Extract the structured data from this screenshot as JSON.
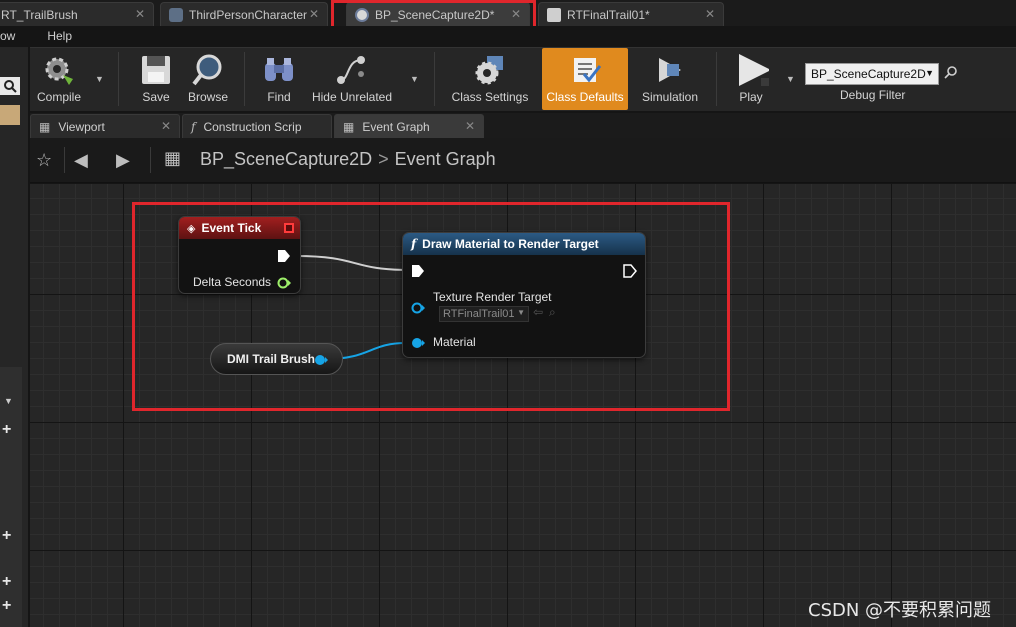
{
  "doc_tabs": [
    {
      "label": "RT_TrailBrush",
      "active": false
    },
    {
      "label": "ThirdPersonCharacter",
      "active": false
    },
    {
      "label": "BP_SceneCapture2D*",
      "active": true
    },
    {
      "label": "RTFinalTrail01*",
      "active": false
    }
  ],
  "menu": {
    "window": "ow",
    "help": "Help"
  },
  "toolbar": {
    "compile": "Compile",
    "save": "Save",
    "browse": "Browse",
    "find": "Find",
    "hide_unrelated": "Hide Unrelated",
    "class_settings": "Class Settings",
    "class_defaults": "Class Defaults",
    "simulation": "Simulation",
    "play": "Play",
    "debug_value": "BP_SceneCapture2D",
    "debug_label": "Debug Filter"
  },
  "panel_tabs": [
    {
      "label": "Viewport",
      "active": false
    },
    {
      "label": "Construction Scrip",
      "active": false
    },
    {
      "label": "Event Graph",
      "active": true
    }
  ],
  "breadcrumb": {
    "blueprint": "BP_SceneCapture2D",
    "separator": ">",
    "graph": "Event Graph"
  },
  "nodes": {
    "event_tick": {
      "title": "Event Tick",
      "pin_delta": "Delta Seconds"
    },
    "draw_material": {
      "title": "Draw Material to Render Target",
      "pin_texture": "Texture Render Target",
      "texture_value": "RTFinalTrail01",
      "pin_material": "Material"
    },
    "dmi_var": {
      "label": "DMI Trail Brush"
    }
  },
  "colors": {
    "highlight": "#e0262c",
    "event_header": "#8e1b1b",
    "function_header": "#1f3f5c",
    "class_defaults": "#e08a1e",
    "object_pin": "#16a4e6",
    "float_pin": "#9ef06a"
  },
  "watermark": "CSDN @不要积累问题"
}
